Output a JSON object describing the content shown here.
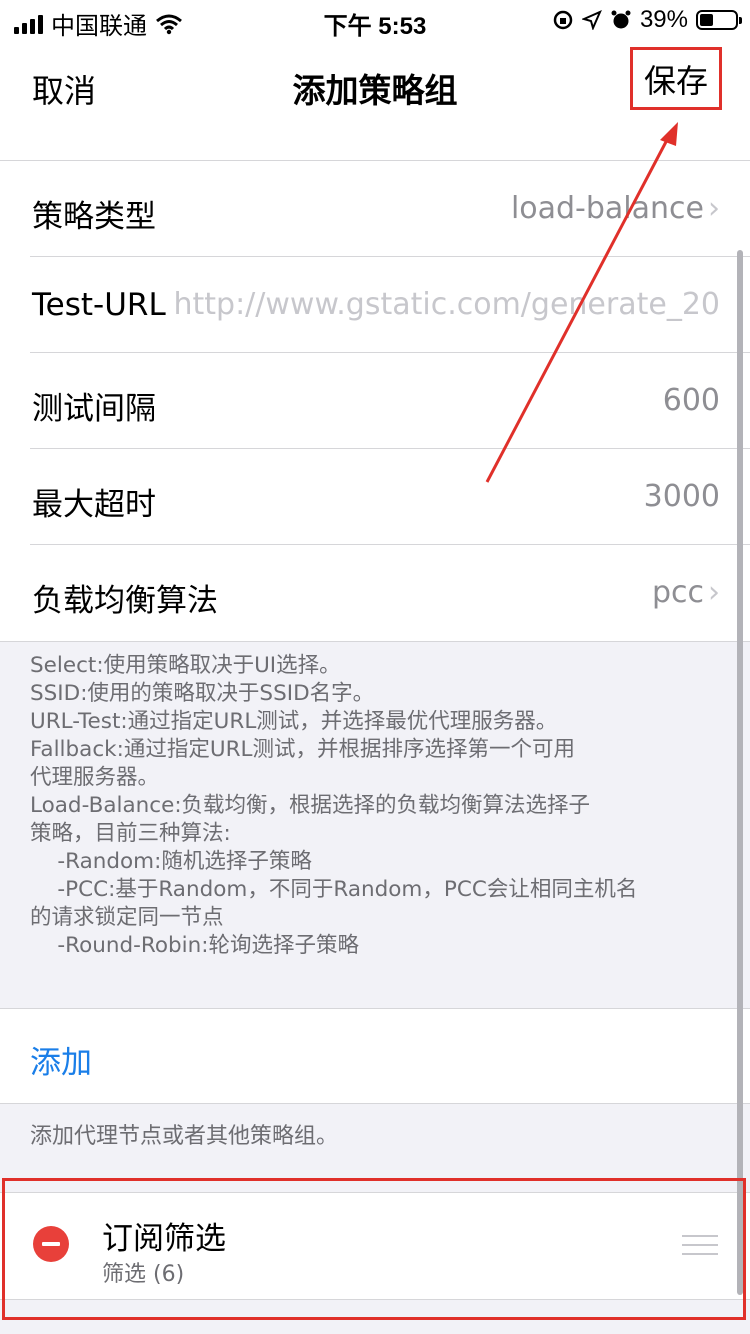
{
  "status_bar": {
    "carrier": "中国联通",
    "time": "下午 5:53",
    "battery_percent": "39%",
    "battery_level": 0.39,
    "icons": [
      "signal-icon",
      "wifi-icon",
      "orientation-lock-icon",
      "location-icon",
      "alarm-icon",
      "battery-icon"
    ]
  },
  "nav": {
    "cancel_label": "取消",
    "title": "添加策略组",
    "save_label": "保存"
  },
  "settings": {
    "policy_type": {
      "label": "策略类型",
      "value": "load-balance"
    },
    "test_url": {
      "label": "Test-URL",
      "placeholder": "http://www.gstatic.com/generate_20"
    },
    "test_interval": {
      "label": "测试间隔",
      "value": "600"
    },
    "max_timeout": {
      "label": "最大超时",
      "value": "3000"
    },
    "lb_algorithm": {
      "label": "负载均衡算法",
      "value": "pcc"
    }
  },
  "description": "Select:使用策略取决于UI选择。\nSSID:使用的策略取决于SSID名字。\nURL-Test:通过指定URL测试，并选择最优代理服务器。\nFallback:通过指定URL测试，并根据排序选择第一个可用\n代理服务器。\nLoad-Balance:负载均衡，根据选择的负载均衡算法选择子\n策略，目前三种算法:\n    -Random:随机选择子策略\n    -PCC:基于Random，不同于Random，PCC会让相同主机名\n的请求锁定同一节点\n    -Round-Robin:轮询选择子策略",
  "add": {
    "label": "添加",
    "hint": "添加代理节点或者其他策略组。"
  },
  "subscription": {
    "title": "订阅筛选",
    "detail": "筛选 (6)"
  },
  "colors": {
    "accent": "#1a7ee8",
    "annotation_red": "#e0302a",
    "delete_red": "#e8403a",
    "background": "#f2f2f7"
  }
}
